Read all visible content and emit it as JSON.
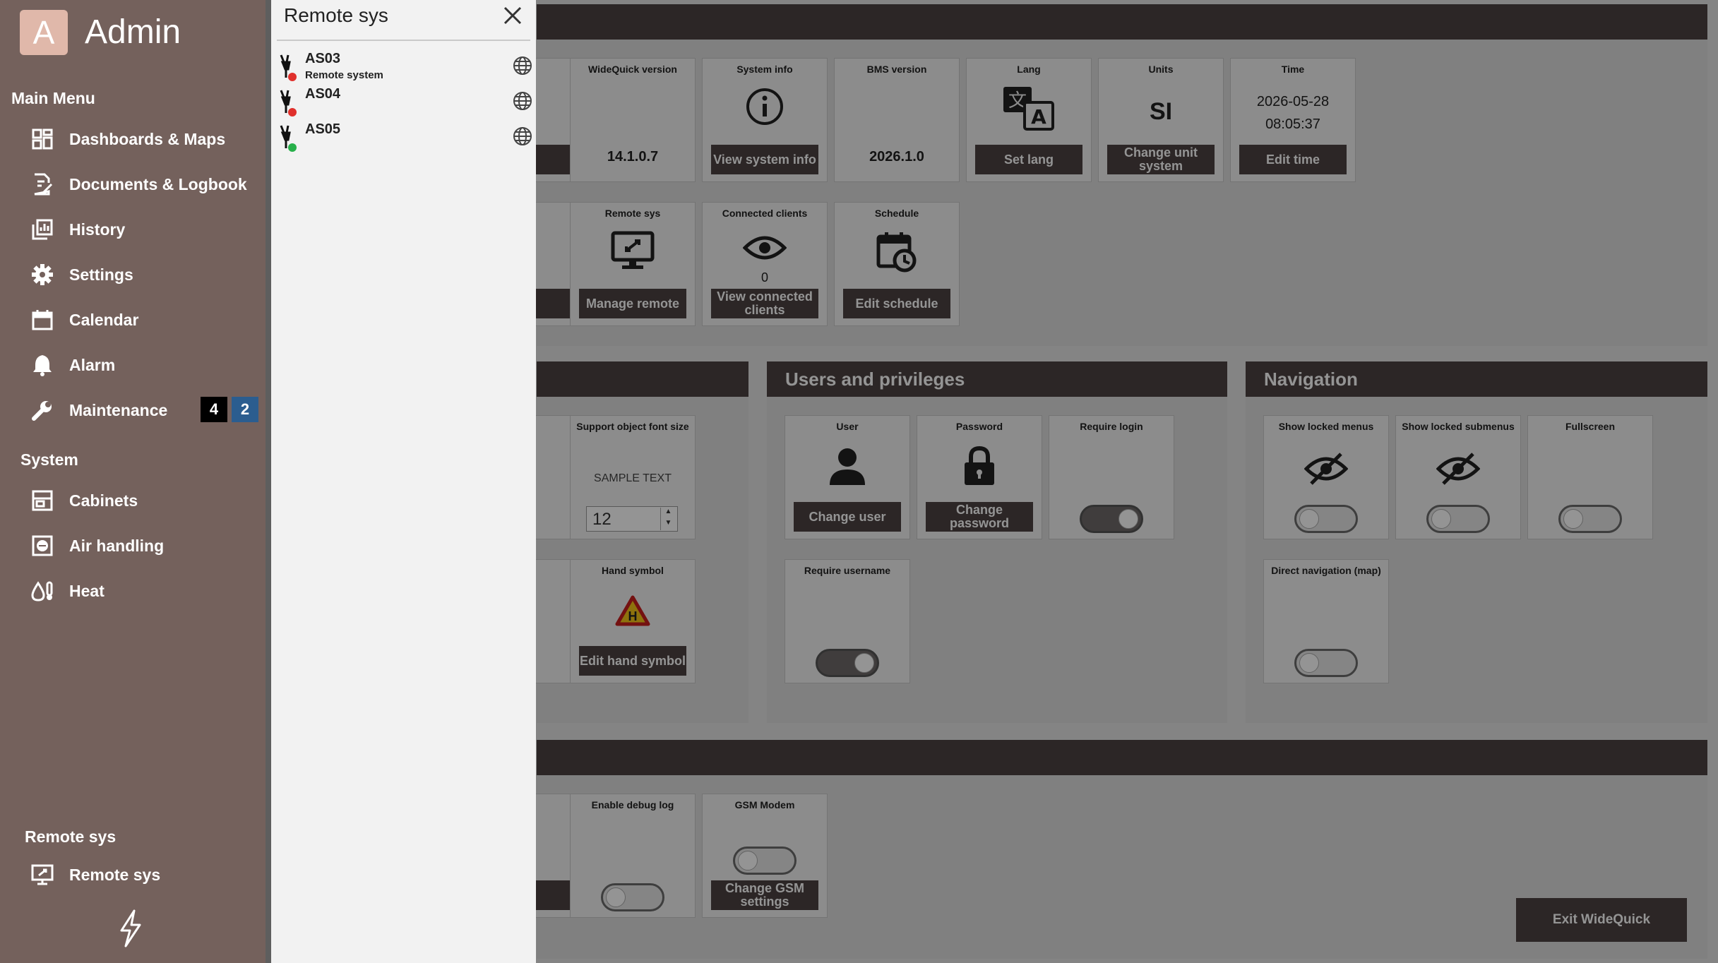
{
  "sidebar": {
    "avatar_letter": "A",
    "user_name": "Admin",
    "main_menu_heading": "Main Menu",
    "items": [
      {
        "label": "Dashboards & Maps",
        "icon": "dashboard-icon"
      },
      {
        "label": "Documents & Logbook",
        "icon": "document-edit-icon"
      },
      {
        "label": "History",
        "icon": "history-chart-icon"
      },
      {
        "label": "Settings",
        "icon": "gear-icon"
      },
      {
        "label": "Calendar",
        "icon": "calendar-icon"
      },
      {
        "label": "Alarm",
        "icon": "bell-icon"
      },
      {
        "label": "Maintenance",
        "icon": "wrench-icon"
      }
    ],
    "maintenance_badges": [
      "4",
      "2"
    ],
    "system_heading": "System",
    "system_items": [
      {
        "label": "Cabinets",
        "icon": "cabinet-icon"
      },
      {
        "label": "Air handling",
        "icon": "air-handling-icon"
      },
      {
        "label": "Heat",
        "icon": "heat-icon"
      }
    ],
    "remote_heading": "Remote sys",
    "remote_item": {
      "label": "Remote sys",
      "icon": "remote-desktop-icon"
    },
    "footer_icon": "lightning-icon"
  },
  "panel": {
    "title": "Remote sys",
    "systems": [
      {
        "name": "AS03",
        "subtitle": "Remote system",
        "status": "red"
      },
      {
        "name": "AS04",
        "subtitle": "",
        "status": "red"
      },
      {
        "name": "AS05",
        "subtitle": "",
        "status": "green"
      }
    ]
  },
  "tiles": {
    "widequick_version": {
      "title": "WideQuick version",
      "value": "14.1.0.7"
    },
    "system_info": {
      "title": "System info",
      "button": "View system info"
    },
    "bms_version": {
      "title": "BMS version",
      "value": "2026.1.0"
    },
    "lang": {
      "title": "Lang",
      "button": "Set lang"
    },
    "units": {
      "title": "Units",
      "value": "SI",
      "button": "Change unit system"
    },
    "time": {
      "title": "Time",
      "date": "2026-05-28",
      "clock": "08:05:37",
      "button": "Edit time"
    },
    "remote_sys": {
      "title": "Remote sys",
      "button": "Manage remote"
    },
    "connected_clients": {
      "title": "Connected clients",
      "value": "0",
      "button": "View connected clients"
    },
    "schedule": {
      "title": "Schedule",
      "button": "Edit schedule"
    },
    "font_size": {
      "title": "Support object font size",
      "sample": "SAMPLE TEXT",
      "value": "12"
    },
    "hand_symbol": {
      "title": "Hand symbol",
      "glyph": "H",
      "button": "Edit hand symbol"
    },
    "user": {
      "title": "User",
      "button": "Change user"
    },
    "password": {
      "title": "Password",
      "button": "Change password"
    },
    "require_login": {
      "title": "Require login",
      "on": true
    },
    "require_username": {
      "title": "Require username",
      "on": true
    },
    "show_locked_menus": {
      "title": "Show locked menus",
      "on": false
    },
    "show_locked_submenus": {
      "title": "Show locked submenus",
      "on": false
    },
    "fullscreen": {
      "title": "Fullscreen",
      "on": false
    },
    "direct_navigation": {
      "title": "Direct navigation (map)",
      "on": false
    },
    "debug_log": {
      "title": "Enable debug log",
      "on": false
    },
    "gsm_modem": {
      "title": "GSM Modem",
      "button": "Change GSM settings",
      "on": false
    }
  },
  "sections": {
    "users": "Users and privileges",
    "navigation": "Navigation"
  },
  "exit_button": "Exit WideQuick",
  "colors": {
    "sidebar_bg": "#74615c",
    "header_bg": "#4c4342",
    "badge_black": "#000000",
    "badge_blue": "#2b5d8f",
    "status_red": "#e0302c",
    "status_green": "#27b04a"
  }
}
